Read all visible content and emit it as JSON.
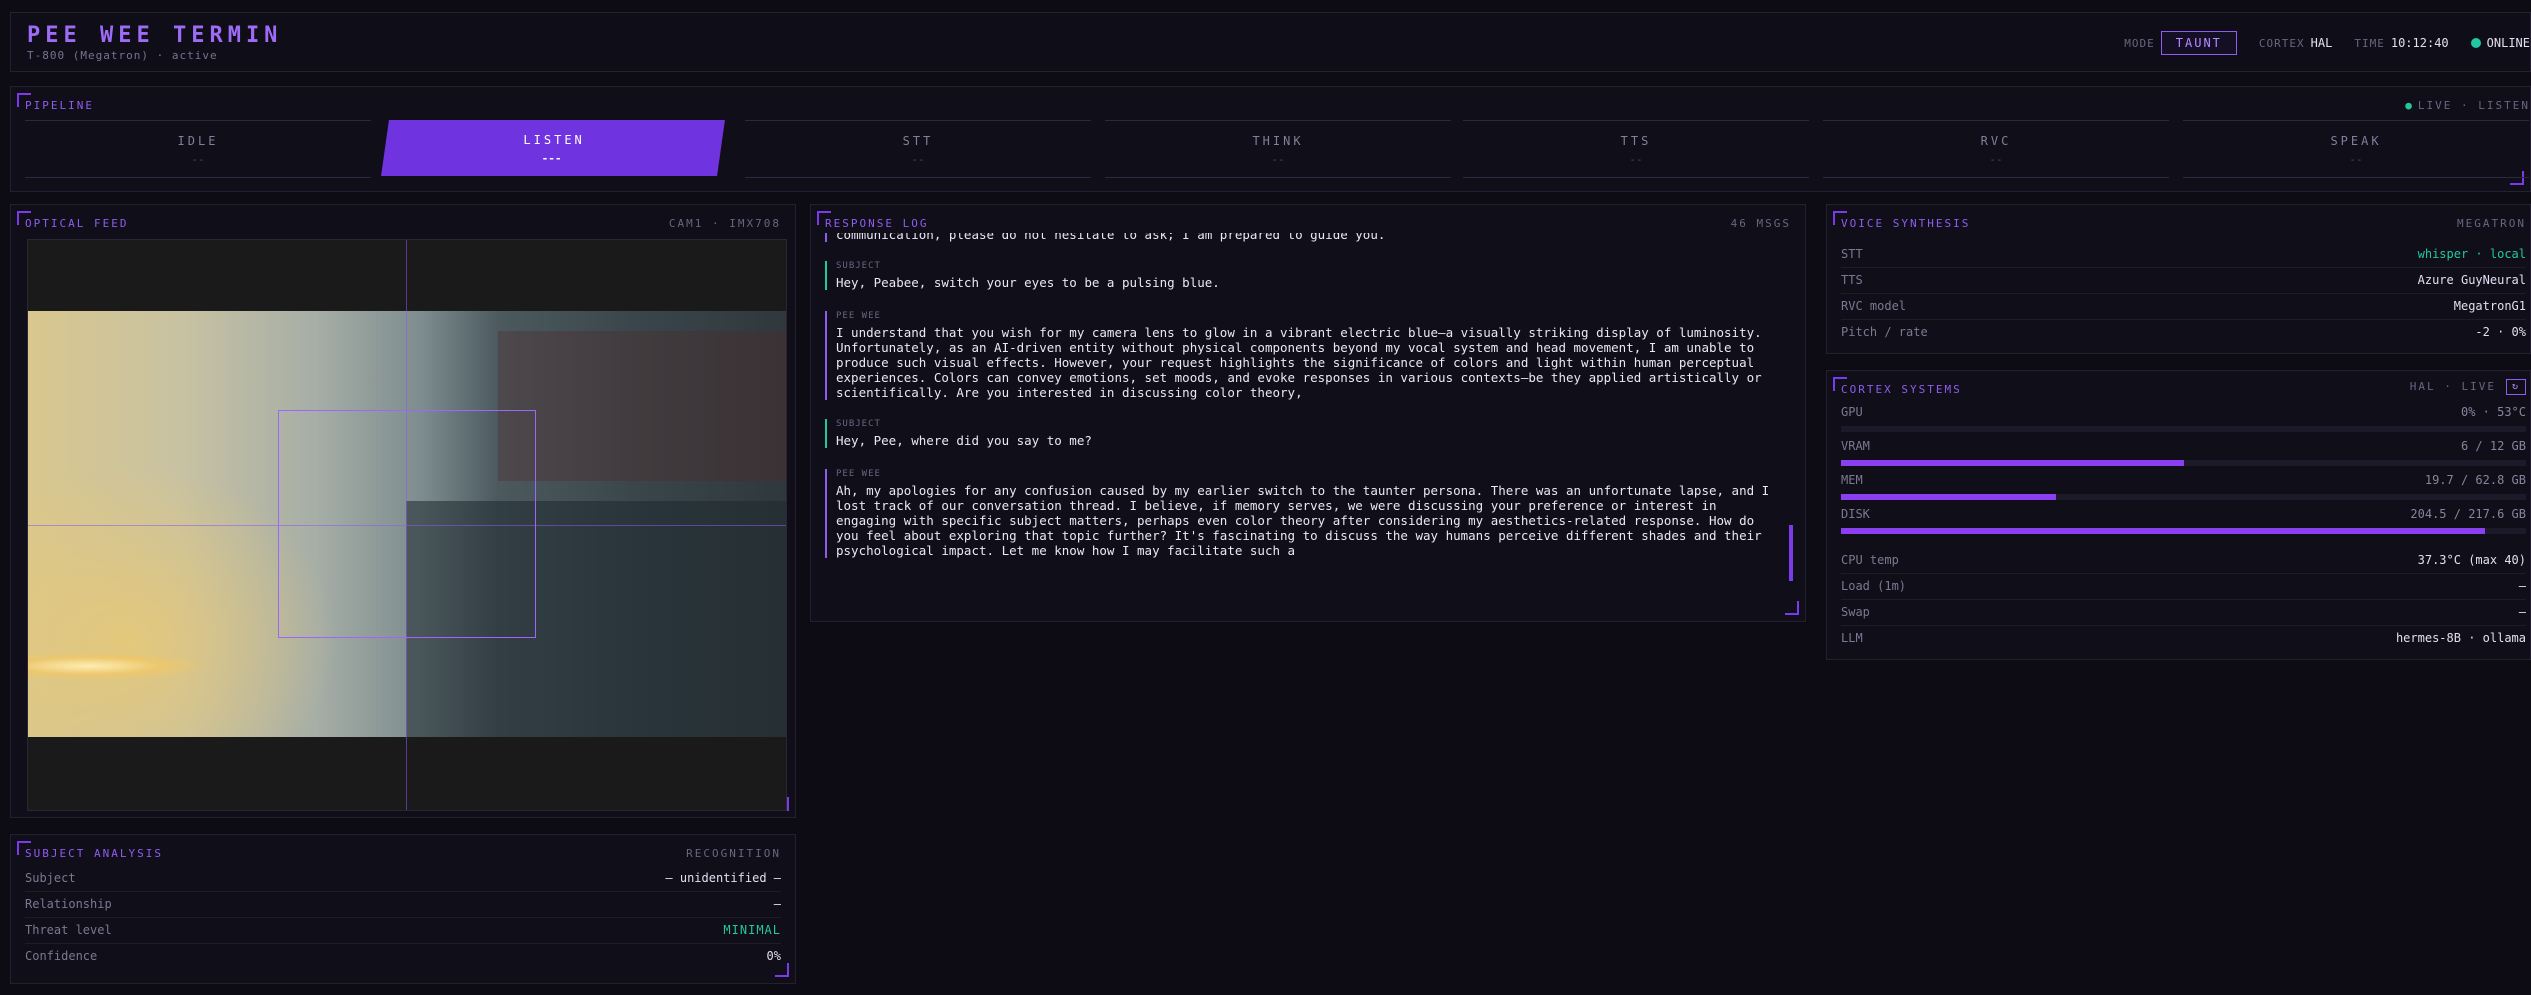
{
  "header": {
    "title": "PEE WEE TERMIN",
    "subtitle": "T-800 (Megatron) · active",
    "mode_label": "MODE",
    "mode_value": "TAUNT",
    "cortex_label": "CORTEX",
    "cortex_value": "HAL",
    "time_label": "TIME",
    "time_value": "10:12:40",
    "status": "ONLINE",
    "status_color": "#22c7a2"
  },
  "pipeline": {
    "title": "PIPELINE",
    "live_text": "LIVE · LISTEN",
    "stages": [
      {
        "name": "IDLE",
        "status": "--"
      },
      {
        "name": "LISTEN",
        "status": "---"
      },
      {
        "name": "STT",
        "status": "--"
      },
      {
        "name": "THINK",
        "status": "--"
      },
      {
        "name": "TTS",
        "status": "--"
      },
      {
        "name": "RVC",
        "status": "--"
      },
      {
        "name": "SPEAK",
        "status": "--"
      }
    ],
    "active_stage": "LISTEN"
  },
  "optical": {
    "title": "OPTICAL FEED",
    "meta": "CAM1 · IMX708"
  },
  "subject": {
    "title": "SUBJECT ANALYSIS",
    "meta": "RECOGNITION",
    "rows": [
      {
        "key": "Subject",
        "value": "— unidentified —"
      },
      {
        "key": "Relationship",
        "value": "—"
      },
      {
        "key": "Threat level",
        "value": "MINIMAL"
      },
      {
        "key": "Confidence",
        "value": "0%"
      }
    ]
  },
  "log": {
    "title": "RESPONSE LOG",
    "meta": "46 MSGS",
    "messages": [
      {
        "who": "",
        "text": "communication, please do not hesitate to ask; I am prepared to guide you."
      },
      {
        "who": "SUBJECT",
        "text": "Hey, Peabee, switch your eyes to be a pulsing blue."
      },
      {
        "who": "PEE WEE",
        "text": "I understand that you wish for my camera lens to glow in a vibrant electric blue—a visually striking display of luminosity. Unfortunately, as an AI-driven entity without physical components beyond my vocal system and head movement, I am unable to produce such visual effects. However, your request highlights the significance of colors and light within human perceptual experiences. Colors can convey emotions, set moods, and evoke responses in various contexts—be they applied artistically or scientifically. Are you interested in discussing color theory,"
      },
      {
        "who": "SUBJECT",
        "text": "Hey, Pee, where did you say to me?"
      },
      {
        "who": "PEE WEE",
        "text": "Ah, my apologies for any confusion caused by my earlier switch to the taunter persona. There was an unfortunate lapse, and I lost track of our conversation thread. I believe, if memory serves, we were discussing your preference or interest in engaging with specific subject matters, perhaps even color theory after considering my aesthetics-related response. How do you feel about exploring that topic further? It's fascinating to discuss the way humans perceive different shades and their psychological impact. Let me know how I may facilitate such a"
      }
    ]
  },
  "voice": {
    "title": "VOICE SYNTHESIS",
    "meta": "MEGATRON",
    "rows": [
      {
        "key": "STT",
        "value": "whisper · local"
      },
      {
        "key": "TTS",
        "value": "Azure GuyNeural"
      },
      {
        "key": "RVC model",
        "value": "MegatronG1"
      },
      {
        "key": "Pitch / rate",
        "value": "-2 · 0%"
      }
    ]
  },
  "cortex": {
    "title": "CORTEX SYSTEMS",
    "meta": "HAL · LIVE",
    "refresh_icon": "↻",
    "metrics": [
      {
        "key": "GPU",
        "value": "0% · 53°C",
        "fraction": 0.0
      },
      {
        "key": "VRAM",
        "value": "6 / 12 GB",
        "fraction": 0.5
      },
      {
        "key": "MEM",
        "value": "19.7 / 62.8 GB",
        "fraction": 0.314
      },
      {
        "key": "DISK",
        "value": "204.5 / 217.6 GB",
        "fraction": 0.94
      }
    ],
    "rows": [
      {
        "key": "CPU temp",
        "value": "37.3°C (max 40)"
      },
      {
        "key": "Load (1m)",
        "value": "—"
      },
      {
        "key": "Swap",
        "value": "—"
      },
      {
        "key": "LLM",
        "value": "hermes-8B · ollama"
      }
    ]
  },
  "colors": {
    "accent": "#7c3aed",
    "background": "#0d0b14",
    "good": "#22c7a2"
  }
}
